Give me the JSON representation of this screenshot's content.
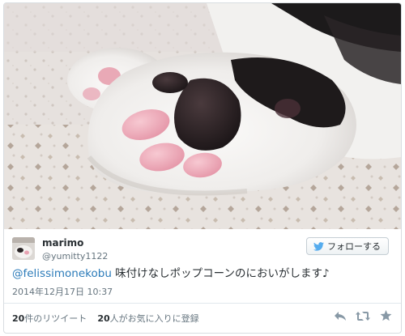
{
  "tweet": {
    "author": {
      "display_name": "marimo",
      "handle": "@yumitty1122",
      "avatar_icon": "cat-avatar-icon"
    },
    "follow_button": {
      "label": "フォローする",
      "icon": "bird-icon"
    },
    "text": {
      "mention": "@felissimonekobu",
      "body": " 味付けなしポップコーンのにおいがします♪"
    },
    "timestamp": "2014年12月17日 10:37",
    "stats": {
      "retweets_count": "20",
      "retweets_label": "件のリツイート",
      "favorites_count": "20",
      "favorites_label": "人がお気に入りに登録"
    },
    "actions": [
      {
        "name": "reply",
        "icon": "reply-icon"
      },
      {
        "name": "retweet",
        "icon": "retweet-icon"
      },
      {
        "name": "favorite",
        "icon": "star-icon"
      }
    ],
    "colors": {
      "link": "#2b7bb9",
      "muted_text": "#66757f",
      "text": "#292f33",
      "border": "#e1e8ed"
    }
  }
}
